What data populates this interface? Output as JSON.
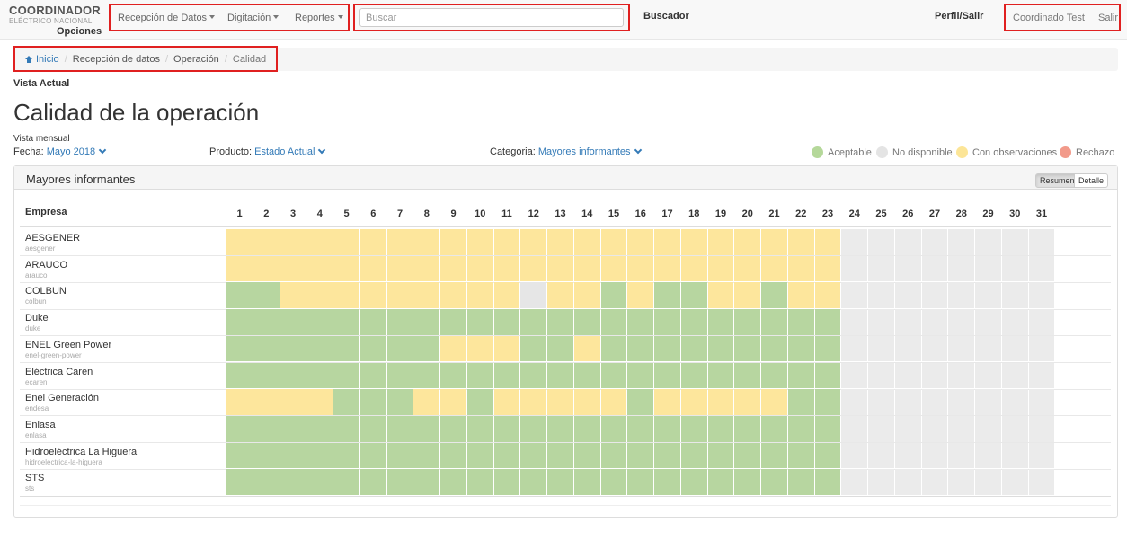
{
  "brand": {
    "title": "COORDINADOR",
    "subtitle": "ELÉCTRICO NACIONAL",
    "options_label": "Opciones"
  },
  "nav": {
    "items": [
      {
        "label": "Recepción de Datos"
      },
      {
        "label": "Digitación"
      },
      {
        "label": "Reportes"
      }
    ]
  },
  "search": {
    "placeholder": "Buscar",
    "label": "Buscador"
  },
  "profile": {
    "label": "Perfil/Salir",
    "user": "Coordinado Test",
    "logout": "Salir"
  },
  "breadcrumb": {
    "home": "Inicio",
    "items": [
      "Recepción de datos",
      "Operación"
    ],
    "active": "Calidad"
  },
  "vista_actual": "Vista Actual",
  "page_title": "Calidad de la operación",
  "vista_mensual": "Vista mensual",
  "filters": {
    "fecha": {
      "label": "Fecha:",
      "value": "Mayo 2018"
    },
    "producto": {
      "label": "Producto:",
      "value": "Estado Actual"
    },
    "categoria": {
      "label": "Categoria:",
      "value": "Mayores informantes"
    }
  },
  "legend": [
    {
      "label": "Aceptable",
      "color": "#b5d89a"
    },
    {
      "label": "No disponible",
      "color": "#e4e4e4"
    },
    {
      "label": "Con observaciones",
      "color": "#fce597"
    },
    {
      "label": "Rechazo",
      "color": "#f29a8a"
    }
  ],
  "status_colors": {
    "A": "#b7d6a0",
    "O": "#fde69c",
    "N": "#e6e6e6",
    "E": "#ebebeb",
    "R": "#f29a8a"
  },
  "panel": {
    "title": "Mayores informantes",
    "buttons": [
      "Resumen",
      "Detalle"
    ],
    "active_button": "Resumen"
  },
  "table": {
    "empresa_header": "Empresa",
    "days": [
      "1",
      "2",
      "3",
      "4",
      "5",
      "6",
      "7",
      "8",
      "9",
      "10",
      "11",
      "12",
      "13",
      "14",
      "15",
      "16",
      "17",
      "18",
      "19",
      "20",
      "21",
      "22",
      "23",
      "24",
      "25",
      "26",
      "27",
      "28",
      "29",
      "30",
      "31"
    ],
    "rows": [
      {
        "name": "AESGENER",
        "slug": "aesgener",
        "status": "OOOOOOOOOOOOOOOOOOOOOOOEEEEEEEE"
      },
      {
        "name": "ARAUCO",
        "slug": "arauco",
        "status": "OOOOOOOOOOOOOOOOOOOOOOOEEEEEEEE"
      },
      {
        "name": "COLBUN",
        "slug": "colbun",
        "status": "AAOOOOOOOOONOOAOAAOOAOOEEEEEEEE"
      },
      {
        "name": "Duke",
        "slug": "duke",
        "status": "AAAAAAAAAAAAAAAAAAAAAAAEEEEEEEE"
      },
      {
        "name": "ENEL Green Power",
        "slug": "enel-green-power",
        "status": "AAAAAAAAOOOAAOAAAAAAAAAEEEEEEEE"
      },
      {
        "name": "Eléctrica Caren",
        "slug": "ecaren",
        "status": "AAAAAAAAAAAAAAAAAAAAAAAEEEEEEEE"
      },
      {
        "name": "Enel Generación",
        "slug": "endesa",
        "status": "OOOOAAAOOAOOOOOAOOOOOAAEEEEEEEE"
      },
      {
        "name": "Enlasa",
        "slug": "enlasa",
        "status": "AAAAAAAAAAAAAAAAAAAAAAAEEEEEEEE"
      },
      {
        "name": "Hidroeléctrica La Higuera",
        "slug": "hidroelectrica-la-higuera",
        "status": "AAAAAAAAAAAAAAAAAAAAAAAEEEEEEEE"
      },
      {
        "name": "STS",
        "slug": "sts",
        "status": "AAAAAAAAAAAAAAAAAAAAAAAEEEEEEEE"
      }
    ]
  }
}
